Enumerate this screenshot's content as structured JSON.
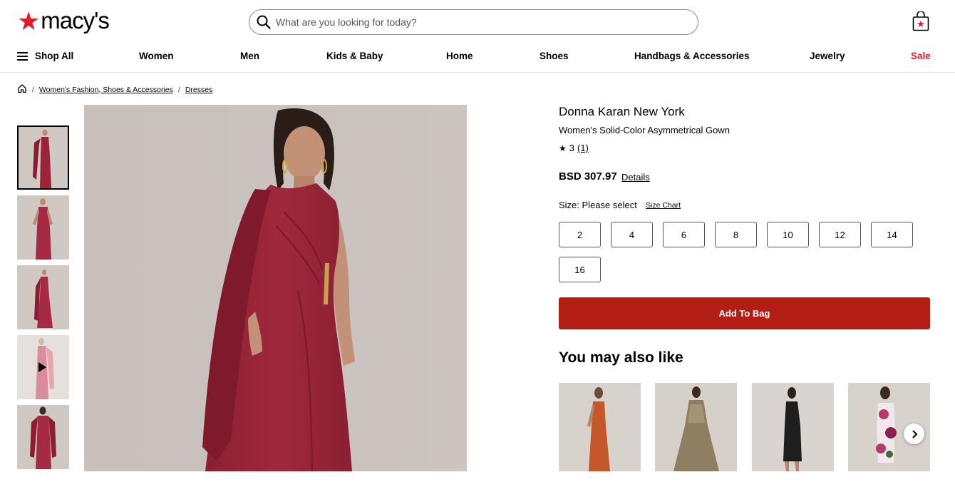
{
  "header": {
    "logo_text": "macy's",
    "search_placeholder": "What are you looking for today?"
  },
  "nav": {
    "shop_all": "Shop All",
    "items": [
      "Women",
      "Men",
      "Kids & Baby",
      "Home",
      "Shoes",
      "Handbags & Accessories",
      "Jewelry",
      "Sale"
    ]
  },
  "breadcrumb": {
    "items": [
      "Women's Fashion, Shoes & Accessories",
      "Dresses"
    ],
    "separator": "/"
  },
  "thumbnails": [
    {
      "label": "",
      "video": false
    },
    {
      "label": "",
      "video": false
    },
    {
      "label": "",
      "video": false
    },
    {
      "label": "",
      "video": true
    },
    {
      "label": "",
      "video": false
    }
  ],
  "product": {
    "brand": "Donna Karan New York",
    "name": "Women's Solid-Color Asymmetrical Gown",
    "rating": "3",
    "review_count": "(1)",
    "price": "BSD 307.97",
    "details_link": "Details",
    "size_label": "Size: Please select",
    "size_chart": "Size Chart",
    "sizes": [
      "2",
      "4",
      "6",
      "8",
      "10",
      "12",
      "14",
      "16"
    ],
    "add_to_bag": "Add To Bag"
  },
  "recommendations": {
    "title": "You may also like",
    "dress_colors": [
      "#c4582a",
      "#8f7f62",
      "#1e1e1e",
      "#b43a6a"
    ]
  },
  "colors": {
    "brand_red": "#e21a2c",
    "add_to_bag_bg": "#b21e14",
    "gown": "#9c2438",
    "image_bg": "#c9c2be"
  }
}
